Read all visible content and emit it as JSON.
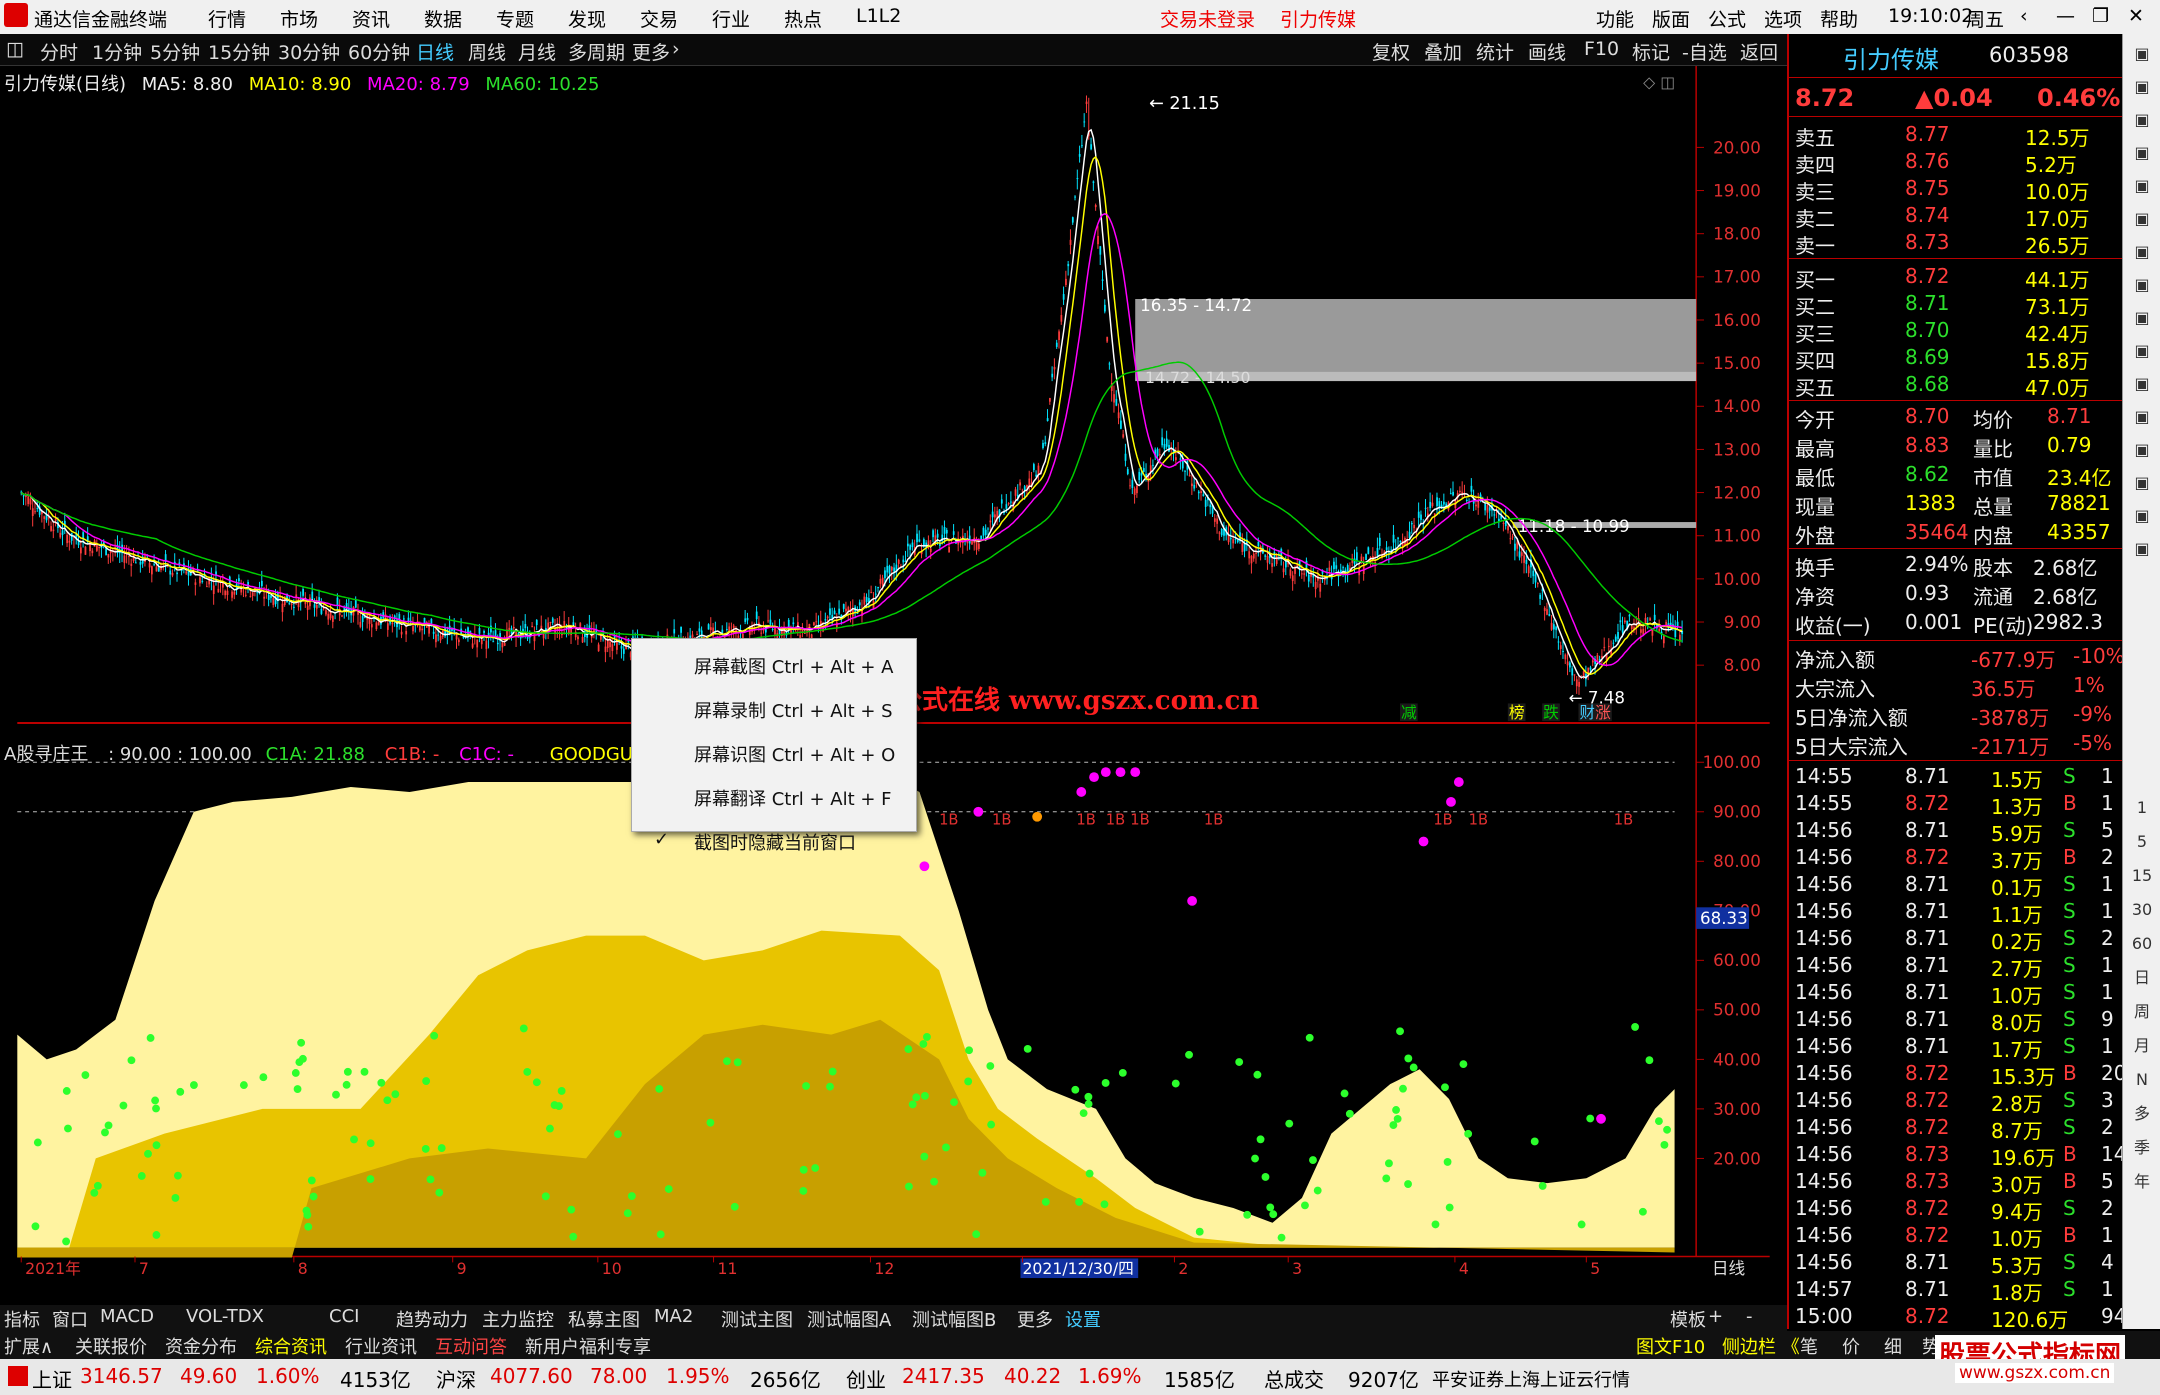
{
  "titlebar": {
    "app": "通达信金融终端",
    "menus": [
      "行情",
      "市场",
      "资讯",
      "数据",
      "专题",
      "发现",
      "交易",
      "行业",
      "热点",
      "L1L2"
    ],
    "login": "交易未登录",
    "stock": "引力传媒",
    "right_menus": [
      "功能",
      "版面",
      "公式",
      "选项",
      "帮助"
    ],
    "time": "19:10:02",
    "weekday": "周五"
  },
  "toolbar": {
    "periods": [
      "分时",
      "1分钟",
      "5分钟",
      "15分钟",
      "30分钟",
      "60分钟",
      "日线",
      "周线",
      "月线",
      "多周期",
      "更多"
    ],
    "active": "日线",
    "tools": [
      "复权",
      "叠加",
      "统计",
      "画线",
      "F10",
      "标记",
      "-自选",
      "返回"
    ]
  },
  "main_chart": {
    "title": "引力传媒(日线)",
    "ma5": "MA5: 8.80",
    "ma10": "MA10: 8.90",
    "ma20": "MA20: 8.79",
    "ma60": "MA60: 10.25",
    "high_label": "21.15",
    "low_label": "7.48",
    "box1": "16.35 - 14.72",
    "box2": "14.72 - 14.50",
    "box3": "11.18 - 10.99",
    "y_ticks": [
      "20.00",
      "19.00",
      "18.00",
      "17.00",
      "16.00",
      "15.00",
      "14.00",
      "13.00",
      "12.00",
      "11.00",
      "10.00",
      "9.00",
      "8.00"
    ],
    "tags": [
      "减",
      "榜",
      "跌",
      "财",
      "涨"
    ]
  },
  "sub_chart": {
    "title": "A股寻庄王",
    "params": ": 90.00 : 100.00",
    "c1a": "C1A: 21.88",
    "c1b": "C1B: -",
    "c1c": "C1C: -",
    "good": "GOODGUPIAO",
    "y_ticks": [
      "100.00",
      "90.00",
      "80.00",
      "70.00",
      "60.00",
      "50.00",
      "40.00",
      "30.00",
      "20.00"
    ],
    "cursor_value": "68.33",
    "marker": "1B"
  },
  "x_axis": {
    "labels": [
      "2021年",
      "7",
      "8",
      "9",
      "10",
      "11",
      "12",
      "2021/12/30/四",
      "2",
      "3",
      "4",
      "5"
    ],
    "right": "日线"
  },
  "context_menu": {
    "items": [
      "屏幕截图 Ctrl + Alt + A",
      "屏幕录制 Ctrl + Alt + S",
      "屏幕识图 Ctrl + Alt + O",
      "屏幕翻译 Ctrl + Alt + F",
      "截图时隐藏当前窗口"
    ]
  },
  "watermark": "公式在线 www.gszx.com.cn",
  "watermark2": "股票公式指标网",
  "watermark3": "www.gszx.com.cn",
  "bottom_tabs": [
    "指标",
    "窗口",
    "MACD",
    "VOL-TDX",
    "CCI",
    "趋势动力",
    "主力监控",
    "私募主图",
    "MA2",
    "测试主图",
    "测试幅图A",
    "测试幅图B",
    "更多",
    "设置"
  ],
  "bottom_right": [
    "模板",
    "+",
    "-"
  ],
  "bottom_tabs2": [
    "扩展∧",
    "关联报价",
    "资金分布",
    "综合资讯",
    "行业资讯",
    "互动问答",
    "新用户福利专享"
  ],
  "bottom_tabs2_right": [
    "图文F10",
    "侧边栏 《",
    "笔",
    "价",
    "细",
    "势"
  ],
  "statusbar": {
    "sh_label": "上证",
    "sh": "3146.57",
    "sh_chg": "49.60",
    "sh_pct": "1.60%",
    "sh_amt": "4153亿",
    "sz_label": "沪深",
    "sz": "4077.60",
    "sz_chg": "78.00",
    "sz_pct": "1.95%",
    "sz_amt": "2656亿",
    "cy_label": "创业",
    "cy": "2417.35",
    "cy_chg": "40.22",
    "cy_pct": "1.69%",
    "cy_amt": "1585亿",
    "total_label": "总成交",
    "total": "9207亿",
    "broker": "平安证券上海上证云行情"
  },
  "quote": {
    "name": "引力传媒",
    "code": "603598",
    "price": "8.72",
    "chg": "▲0.04",
    "pct": "0.46%",
    "asks": [
      [
        "卖五",
        "8.77",
        "12.5万"
      ],
      [
        "卖四",
        "8.76",
        "5.2万"
      ],
      [
        "卖三",
        "8.75",
        "10.0万"
      ],
      [
        "卖二",
        "8.74",
        "17.0万"
      ],
      [
        "卖一",
        "8.73",
        "26.5万"
      ]
    ],
    "bids": [
      [
        "买一",
        "8.72",
        "44.1万"
      ],
      [
        "买二",
        "8.71",
        "73.1万"
      ],
      [
        "买三",
        "8.70",
        "42.4万"
      ],
      [
        "买四",
        "8.69",
        "15.8万"
      ],
      [
        "买五",
        "8.68",
        "47.0万"
      ]
    ],
    "stats": [
      [
        "今开",
        "8.70",
        "均价",
        "8.71"
      ],
      [
        "最高",
        "8.83",
        "量比",
        "0.79"
      ],
      [
        "最低",
        "8.62",
        "市值",
        "23.4亿"
      ],
      [
        "现量",
        "1383",
        "总量",
        "78821"
      ],
      [
        "外盘",
        "35464",
        "内盘",
        "43357"
      ]
    ],
    "stats2": [
      [
        "换手",
        "2.94%",
        "股本",
        "2.68亿"
      ],
      [
        "净资",
        "0.93",
        "流通",
        "2.68亿"
      ],
      [
        "收益(一)",
        "0.001",
        "PE(动)",
        "2982.3"
      ]
    ],
    "flows": [
      [
        "净流入额",
        "-677.9万",
        "-10%"
      ],
      [
        "大宗流入",
        "36.5万",
        "1%"
      ],
      [
        "5日净流入额",
        "-3878万",
        "-9%"
      ],
      [
        "5日大宗流入",
        "-2171万",
        "-5%"
      ]
    ],
    "ticks": [
      [
        "14:55",
        "8.71",
        "1.5万",
        "S",
        "1"
      ],
      [
        "14:55",
        "8.72",
        "1.3万",
        "B",
        "1"
      ],
      [
        "14:56",
        "8.71",
        "5.9万",
        "S",
        "5"
      ],
      [
        "14:56",
        "8.72",
        "3.7万",
        "B",
        "2"
      ],
      [
        "14:56",
        "8.71",
        "0.1万",
        "S",
        "1"
      ],
      [
        "14:56",
        "8.71",
        "1.1万",
        "S",
        "1"
      ],
      [
        "14:56",
        "8.71",
        "0.2万",
        "S",
        "2"
      ],
      [
        "14:56",
        "8.71",
        "2.7万",
        "S",
        "1"
      ],
      [
        "14:56",
        "8.71",
        "1.0万",
        "S",
        "1"
      ],
      [
        "14:56",
        "8.71",
        "8.0万",
        "S",
        "9"
      ],
      [
        "14:56",
        "8.71",
        "1.7万",
        "S",
        "1"
      ],
      [
        "14:56",
        "8.72",
        "15.3万",
        "B",
        "20"
      ],
      [
        "14:56",
        "8.72",
        "2.8万",
        "S",
        "3"
      ],
      [
        "14:56",
        "8.72",
        "8.7万",
        "S",
        "2"
      ],
      [
        "14:56",
        "8.73",
        "19.6万",
        "B",
        "14"
      ],
      [
        "14:56",
        "8.73",
        "3.0万",
        "B",
        "5"
      ],
      [
        "14:56",
        "8.72",
        "9.4万",
        "S",
        "2"
      ],
      [
        "14:56",
        "8.72",
        "1.0万",
        "B",
        "1"
      ],
      [
        "14:56",
        "8.71",
        "5.3万",
        "S",
        "4"
      ],
      [
        "14:57",
        "8.71",
        "1.8万",
        "S",
        "1"
      ],
      [
        "15:00",
        "8.72",
        "120.6万",
        "",
        "94"
      ]
    ]
  },
  "right_icons": [
    "1",
    "5",
    "15",
    "30",
    "60",
    "日",
    "周",
    "月",
    "N",
    "多",
    "季",
    "年"
  ],
  "colors": {
    "up": "#ff3c3c",
    "down": "#2ce02c",
    "accent": "#4cf",
    "bg": "#000"
  }
}
